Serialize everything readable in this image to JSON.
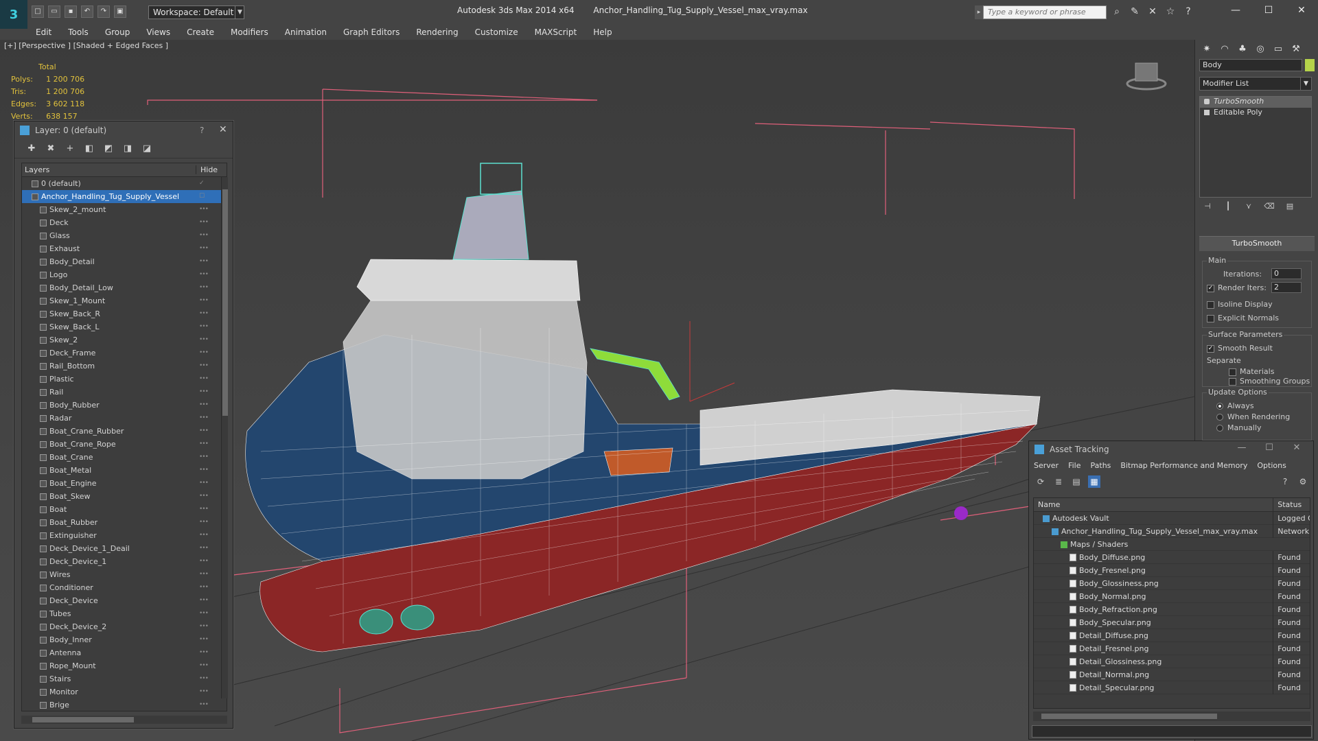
{
  "app": {
    "title": "Autodesk 3ds Max  2014 x64",
    "file": "Anchor_Handling_Tug_Supply_Vessel_max_vray.max",
    "workspace": "Workspace: Default",
    "search_placeholder": "Type a keyword or phrase"
  },
  "menu": [
    "Edit",
    "Tools",
    "Group",
    "Views",
    "Create",
    "Modifiers",
    "Animation",
    "Graph Editors",
    "Rendering",
    "Customize",
    "MAXScript",
    "Help"
  ],
  "viewport": {
    "label": "[+] [Perspective ] [Shaded + Edged Faces ]",
    "stats": {
      "header": "Total",
      "rows": [
        {
          "k": "Polys:",
          "v": "1 200 706"
        },
        {
          "k": "Tris:",
          "v": "1 200 706"
        },
        {
          "k": "Edges:",
          "v": "3 602 118"
        },
        {
          "k": "Verts:",
          "v": "638 157"
        }
      ]
    }
  },
  "layers": {
    "title": "Layer: 0 (default)",
    "help": "?",
    "col_layers": "Layers",
    "col_hide": "Hide",
    "items": [
      {
        "name": "0 (default)",
        "indent": 1
      },
      {
        "name": "Anchor_Handling_Tug_Supply_Vessel",
        "indent": 1,
        "selected": true
      },
      {
        "name": "Skew_2_mount",
        "indent": 2
      },
      {
        "name": "Deck",
        "indent": 2
      },
      {
        "name": "Glass",
        "indent": 2
      },
      {
        "name": "Exhaust",
        "indent": 2
      },
      {
        "name": "Body_Detail",
        "indent": 2
      },
      {
        "name": "Logo",
        "indent": 2
      },
      {
        "name": "Body_Detail_Low",
        "indent": 2
      },
      {
        "name": "Skew_1_Mount",
        "indent": 2
      },
      {
        "name": "Skew_Back_R",
        "indent": 2
      },
      {
        "name": "Skew_Back_L",
        "indent": 2
      },
      {
        "name": "Skew_2",
        "indent": 2
      },
      {
        "name": "Deck_Frame",
        "indent": 2
      },
      {
        "name": "Rail_Bottom",
        "indent": 2
      },
      {
        "name": "Plastic",
        "indent": 2
      },
      {
        "name": "Rail",
        "indent": 2
      },
      {
        "name": "Body_Rubber",
        "indent": 2
      },
      {
        "name": "Radar",
        "indent": 2
      },
      {
        "name": "Boat_Crane_Rubber",
        "indent": 2
      },
      {
        "name": "Boat_Crane_Rope",
        "indent": 2
      },
      {
        "name": "Boat_Crane",
        "indent": 2
      },
      {
        "name": "Boat_Metal",
        "indent": 2
      },
      {
        "name": "Boat_Engine",
        "indent": 2
      },
      {
        "name": "Boat_Skew",
        "indent": 2
      },
      {
        "name": "Boat",
        "indent": 2
      },
      {
        "name": "Boat_Rubber",
        "indent": 2
      },
      {
        "name": "Extinguisher",
        "indent": 2
      },
      {
        "name": "Deck_Device_1_Deail",
        "indent": 2
      },
      {
        "name": "Deck_Device_1",
        "indent": 2
      },
      {
        "name": "Wires",
        "indent": 2
      },
      {
        "name": "Conditioner",
        "indent": 2
      },
      {
        "name": "Deck_Device",
        "indent": 2
      },
      {
        "name": "Tubes",
        "indent": 2
      },
      {
        "name": "Deck_Device_2",
        "indent": 2
      },
      {
        "name": "Body_Inner",
        "indent": 2
      },
      {
        "name": "Antenna",
        "indent": 2
      },
      {
        "name": "Rope_Mount",
        "indent": 2
      },
      {
        "name": "Stairs",
        "indent": 2
      },
      {
        "name": "Monitor",
        "indent": 2
      },
      {
        "name": "Brige",
        "indent": 2
      }
    ]
  },
  "command_panel": {
    "object_name": "Body",
    "modifier_list": "Modifier List",
    "stack": [
      "TurboSmooth",
      "Editable Poly"
    ],
    "rollout": "TurboSmooth",
    "main_label": "Main",
    "iterations_label": "Iterations:",
    "iterations": "0",
    "render_iters_label": "Render Iters:",
    "render_iters": "2",
    "isoline": "Isoline Display",
    "explicit_normals": "Explicit Normals",
    "surface_params": "Surface Parameters",
    "smooth_result": "Smooth Result",
    "separate": "Separate",
    "materials": "Materials",
    "smoothing_groups": "Smoothing Groups",
    "update_options": "Update Options",
    "always": "Always",
    "when_rendering": "When Rendering",
    "manually": "Manually"
  },
  "asset_tracking": {
    "title": "Asset Tracking",
    "menu": [
      "Server",
      "File",
      "Paths",
      "Bitmap Performance and Memory",
      "Options"
    ],
    "col_name": "Name",
    "col_status": "Status",
    "rows": [
      {
        "name": "Autodesk Vault",
        "status": "Logged O",
        "level": 1,
        "icon": "vault"
      },
      {
        "name": "Anchor_Handling_Tug_Supply_Vessel_max_vray.max",
        "status": "Network P",
        "level": 2,
        "icon": "max"
      },
      {
        "name": "Maps / Shaders",
        "status": "",
        "level": 3,
        "icon": "maps"
      },
      {
        "name": "Body_Diffuse.png",
        "status": "Found",
        "level": 4,
        "icon": "file"
      },
      {
        "name": "Body_Fresnel.png",
        "status": "Found",
        "level": 4,
        "icon": "file"
      },
      {
        "name": "Body_Glossiness.png",
        "status": "Found",
        "level": 4,
        "icon": "file"
      },
      {
        "name": "Body_Normal.png",
        "status": "Found",
        "level": 4,
        "icon": "file"
      },
      {
        "name": "Body_Refraction.png",
        "status": "Found",
        "level": 4,
        "icon": "file"
      },
      {
        "name": "Body_Specular.png",
        "status": "Found",
        "level": 4,
        "icon": "file"
      },
      {
        "name": "Detail_Diffuse.png",
        "status": "Found",
        "level": 4,
        "icon": "file"
      },
      {
        "name": "Detail_Fresnel.png",
        "status": "Found",
        "level": 4,
        "icon": "file"
      },
      {
        "name": "Detail_Glossiness.png",
        "status": "Found",
        "level": 4,
        "icon": "file"
      },
      {
        "name": "Detail_Normal.png",
        "status": "Found",
        "level": 4,
        "icon": "file"
      },
      {
        "name": "Detail_Specular.png",
        "status": "Found",
        "level": 4,
        "icon": "file"
      }
    ]
  }
}
